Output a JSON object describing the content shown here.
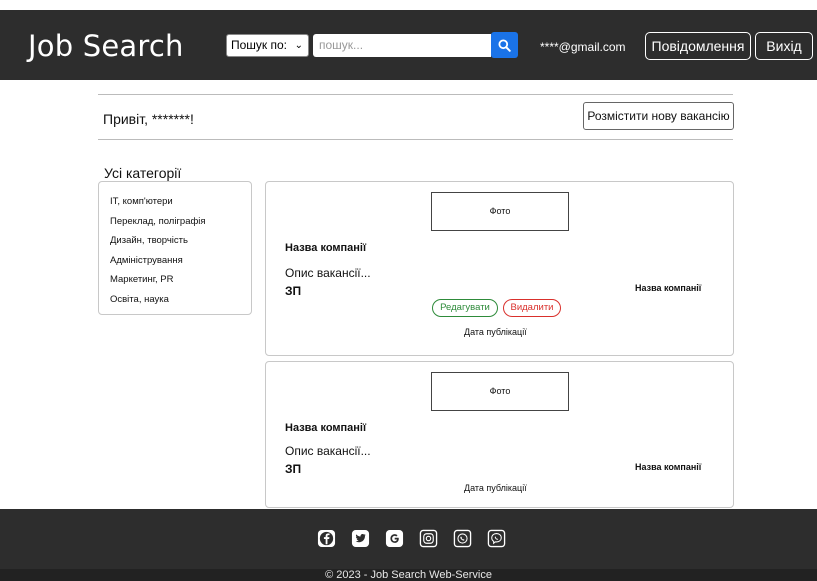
{
  "header": {
    "brand": "Job Search",
    "search_select": "Пошук по:",
    "search_placeholder": "пошук...",
    "email": "****@gmail.com",
    "messages_label": "Повідомлення",
    "exit_label": "Вихід"
  },
  "greeting": {
    "text": "Привіт, *******!",
    "new_vacancy_label": "Розмістити нову вакансію"
  },
  "categories": {
    "title": "Усі категорії",
    "items": [
      "IT, комп'ютери",
      "Переклад, поліграфія",
      "Дизайн, творчість",
      "Адміністрування",
      "Маркетинг, PR",
      "Освіта, наука"
    ]
  },
  "vacancies": [
    {
      "photo": "Фото",
      "company": "Назва компанії",
      "description": "Опис вакансії...",
      "salary": "ЗП",
      "company_right": "Назва компанії",
      "edit_label": "Редагувати",
      "delete_label": "Видалити",
      "date_label": "Дата публікації"
    },
    {
      "photo": "Фото",
      "company": "Назва компанії",
      "description": "Опис вакансії...",
      "salary": "ЗП",
      "company_right": "Назва компанії",
      "date_label": "Дата публікації"
    }
  ],
  "footer": {
    "icons": [
      "facebook-icon",
      "twitter-icon",
      "google-icon",
      "instagram-icon",
      "whatsapp-icon",
      "viber-icon"
    ],
    "copyright": "© 2023 - Job Search Web-Service"
  },
  "colors": {
    "header_bg": "#2d2d2d",
    "search_button": "#1a73e8",
    "edit": "#2e8b3a",
    "delete": "#d9302c"
  }
}
